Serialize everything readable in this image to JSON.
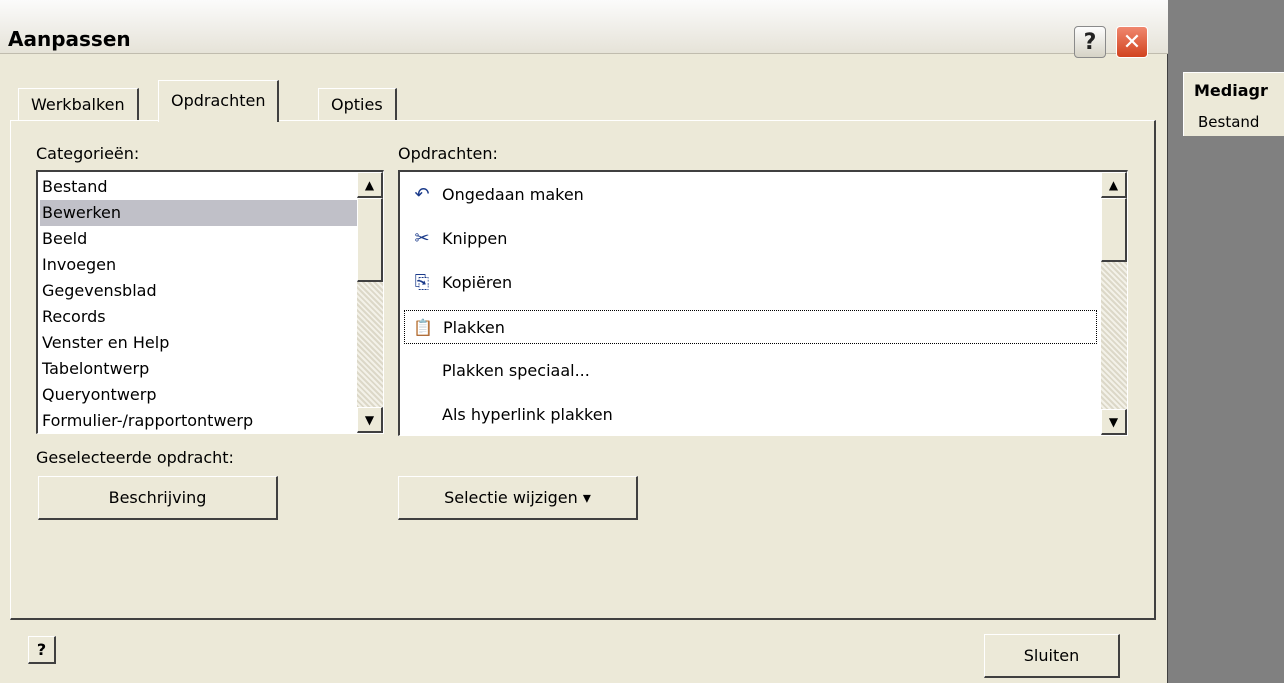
{
  "dialog": {
    "title": "Aanpassen",
    "help_glyph": "?",
    "close_glyph": "✕"
  },
  "tabs": [
    {
      "label": "Werkbalken"
    },
    {
      "label": "Opdrachten"
    },
    {
      "label": "Opties"
    }
  ],
  "categories": {
    "label": "Categorieën:",
    "items": [
      "Bestand",
      "Bewerken",
      "Beeld",
      "Invoegen",
      "Gegevensblad",
      "Records",
      "Venster en Help",
      "Tabelontwerp",
      "Queryontwerp",
      "Formulier-/rapportontwerp"
    ],
    "selected": "Bewerken"
  },
  "commands": {
    "label": "Opdrachten:",
    "items": [
      {
        "label": "Ongedaan maken",
        "icon": "undo-icon",
        "glyph": "↶"
      },
      {
        "label": "Knippen",
        "icon": "scissors-icon",
        "glyph": "✂"
      },
      {
        "label": "Kopiëren",
        "icon": "copy-icon",
        "glyph": "⎘"
      },
      {
        "label": "Plakken",
        "icon": "paste-icon",
        "glyph": "📋"
      },
      {
        "label": "Plakken speciaal...",
        "icon": "",
        "glyph": ""
      },
      {
        "label": "Als hyperlink plakken",
        "icon": "",
        "glyph": ""
      }
    ],
    "focused": "Plakken"
  },
  "selected_command": {
    "label": "Geselecteerde opdracht:",
    "description_button": "Beschrijving",
    "modify_button": "Selectie wijzigen ▾"
  },
  "footer": {
    "close_button": "Sluiten",
    "help_glyph": "?"
  },
  "background_app": {
    "title": "Mediagr",
    "menu_item": "Bestand"
  }
}
